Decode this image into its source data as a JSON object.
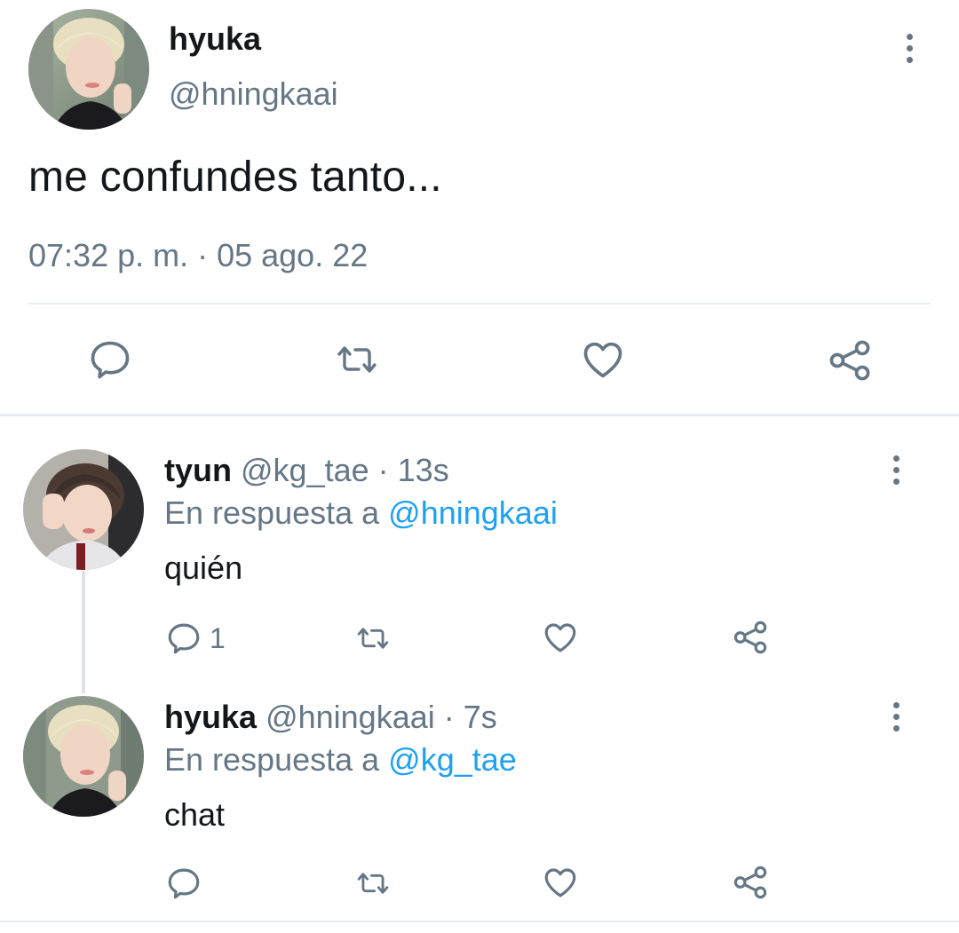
{
  "main_tweet": {
    "display_name": "hyuka",
    "handle": "@hningkaai",
    "text": "me confundes tanto...",
    "timestamp": "07:32 p. m. · 05 ago. 22",
    "actions": {
      "reply_icon": "reply-icon",
      "retweet_icon": "retweet-icon",
      "like_icon": "heart-icon",
      "share_icon": "share-icon"
    }
  },
  "replies": [
    {
      "display_name": "tyun",
      "handle": "@kg_tae",
      "separator": " · ",
      "time": "13s",
      "reply_prefix": "En respuesta a ",
      "reply_to": "@hningkaai",
      "text": "quién",
      "reply_count": "1"
    },
    {
      "display_name": "hyuka",
      "handle": "@hningkaai",
      "separator": " · ",
      "time": "7s",
      "reply_prefix": "En respuesta a ",
      "reply_to": "@kg_tae",
      "text": "chat",
      "reply_count": ""
    }
  ],
  "colors": {
    "text_primary": "#14171a",
    "text_secondary": "#657786",
    "link": "#1da1f2",
    "divider": "#e6ecf0",
    "icon": "#657786"
  }
}
